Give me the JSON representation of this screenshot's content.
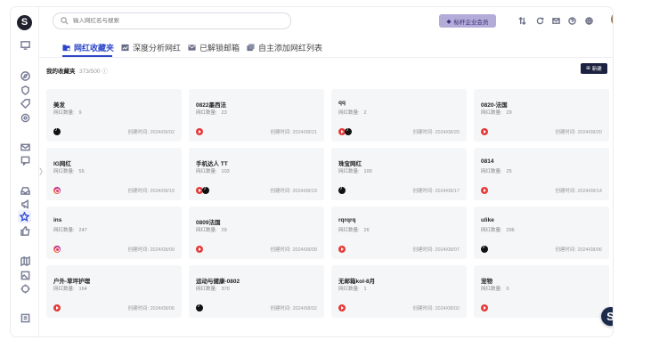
{
  "app": {
    "logo": "S"
  },
  "search": {
    "placeholder": "输入网红名与搜索"
  },
  "header": {
    "vip_label": "标杆企业会员"
  },
  "tabs": [
    {
      "label": "网红收藏夹",
      "icon": "folder-icon"
    },
    {
      "label": "深度分析网红",
      "icon": "analysis-icon"
    },
    {
      "label": "已解锁邮箱",
      "icon": "email-icon"
    },
    {
      "label": "自主添加网红列表",
      "icon": "list-icon"
    }
  ],
  "collection": {
    "title": "我的收藏夹",
    "count": "373/500",
    "new_label": "新建"
  },
  "labels": {
    "count": "网红数量:",
    "created": "创建时间:"
  },
  "cards": [
    {
      "name": "美发",
      "count": "9",
      "date": "2024/09/02",
      "platforms": [
        "tiktok"
      ]
    },
    {
      "name": "0822墨西法",
      "count": "23",
      "date": "2024/08/21",
      "platforms": [
        "youtube"
      ]
    },
    {
      "name": "qq",
      "count": "2",
      "date": "2024/08/20",
      "platforms": [
        "youtube",
        "tiktok"
      ]
    },
    {
      "name": "0820-法国",
      "count": "29",
      "date": "2024/08/20",
      "platforms": [
        "youtube"
      ]
    },
    {
      "name": "IG网红",
      "count": "55",
      "date": "2024/08/19",
      "platforms": [
        "instagram"
      ]
    },
    {
      "name": "手机达人 TT",
      "count": "103",
      "date": "2024/08/19",
      "platforms": [
        "youtube",
        "tiktok"
      ]
    },
    {
      "name": "珠宝网红",
      "count": "100",
      "date": "2024/08/17",
      "platforms": [
        "tiktok"
      ]
    },
    {
      "name": "0814",
      "count": "25",
      "date": "2024/08/14",
      "platforms": [
        "youtube"
      ]
    },
    {
      "name": "ins",
      "count": "247",
      "date": "2024/08/09",
      "platforms": [
        "instagram"
      ]
    },
    {
      "name": "0809法国",
      "count": "29",
      "date": "2024/08/09",
      "platforms": [
        "youtube"
      ]
    },
    {
      "name": "rqrqrq",
      "count": "26",
      "date": "2024/08/07",
      "platforms": [
        "youtube"
      ]
    },
    {
      "name": "ulike",
      "count": "296",
      "date": "2024/08/06",
      "platforms": [
        "tiktok"
      ]
    },
    {
      "name": "户外-草坪护理",
      "count": "164",
      "date": "2024/08/06",
      "platforms": [
        "youtube"
      ]
    },
    {
      "name": "运动与健康-0802",
      "count": "370",
      "date": "2024/08/02",
      "platforms": [
        "tiktok"
      ]
    },
    {
      "name": "无邮箱kol-8月",
      "count": "1",
      "date": "2024/08/02",
      "platforms": [
        "youtube"
      ]
    },
    {
      "name": "宠物",
      "count": "0",
      "date": "",
      "platforms": [
        "youtube"
      ]
    }
  ],
  "sidebar": {
    "icons": [
      "monitor-icon",
      "compass-icon",
      "shield-icon",
      "tag-icon",
      "settings-icon",
      "mail-icon",
      "chat-icon",
      "inbox-icon",
      "megaphone-icon",
      "star-icon",
      "thumb-icon",
      "map-icon",
      "image-icon",
      "target-icon",
      "doc-icon"
    ]
  },
  "colors": {
    "accent": "#2c45c9",
    "vip_bg": "#b4acd8",
    "dark": "#1d2240"
  }
}
